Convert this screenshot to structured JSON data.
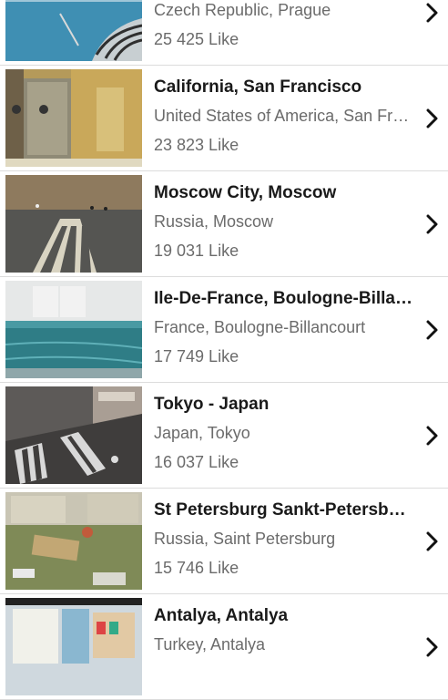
{
  "items": [
    {
      "title": "",
      "subtitle": "Czech Republic, Prague",
      "likes": "25 425 Like",
      "thumb": "pool-stairs"
    },
    {
      "title": "California, San Francisco",
      "subtitle": "United States of America, San Francisco",
      "likes": "23 823 Like",
      "thumb": "corridor-doors"
    },
    {
      "title": "Moscow City, Moscow",
      "subtitle": "Russia, Moscow",
      "likes": "19 031 Like",
      "thumb": "crosswalk"
    },
    {
      "title": "Ile-De-France, Boulogne-Billancourt",
      "subtitle": "France, Boulogne-Billancourt",
      "likes": "17 749 Like",
      "thumb": "indoor-pool"
    },
    {
      "title": "Tokyo - Japan",
      "subtitle": "Japan, Tokyo",
      "likes": "16 037 Like",
      "thumb": "street-crossing"
    },
    {
      "title": "St Petersburg Sankt-Petersburg",
      "subtitle": "Russia, Saint Petersburg",
      "likes": "15 746 Like",
      "thumb": "courtyard"
    },
    {
      "title": "Antalya, Antalya",
      "subtitle": "Turkey, Antalya",
      "likes": "",
      "thumb": "playroom"
    }
  ],
  "icons": {
    "row_action": "chevron-right-icon"
  },
  "colors": {
    "title": "#1a1a1a",
    "secondary": "#6b6b6b",
    "divider": "#dcdcdc"
  }
}
